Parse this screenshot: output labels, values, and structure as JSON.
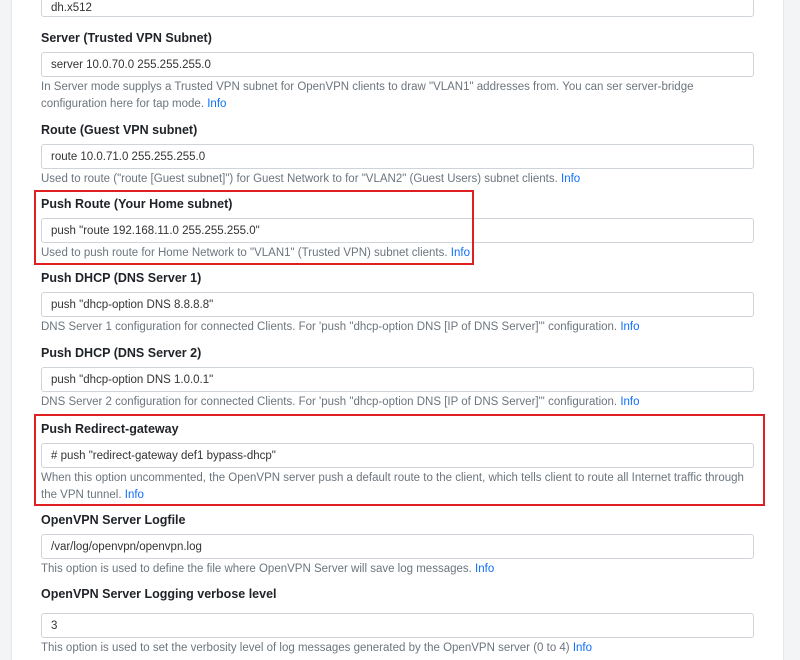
{
  "fields": [
    {
      "label": "",
      "value": "dh.x512",
      "help": "",
      "link": ""
    },
    {
      "label": "Server (Trusted VPN Subnet)",
      "value": "server 10.0.70.0 255.255.255.0",
      "help": "In Server mode supplys a Trusted VPN subnet for OpenVPN clients to draw \"VLAN1\" addresses from. You can ser server-bridge configuration here for tap mode.",
      "link": "Info"
    },
    {
      "label": "Route (Guest VPN subnet)",
      "value": "route 10.0.71.0 255.255.255.0",
      "help": "Used to route (\"route [Guest subnet]\") for Guest Network to for \"VLAN2\" (Guest Users) subnet clients.",
      "link": "Info"
    },
    {
      "label": "Push Route (Your Home subnet)",
      "value": "push \"route 192.168.11.0 255.255.255.0\"",
      "help": "Used to push route for Home Network to \"VLAN1\" (Trusted VPN) subnet clients.",
      "link": "Info"
    },
    {
      "label": "Push DHCP (DNS Server 1)",
      "value": "push \"dhcp-option DNS 8.8.8.8\"",
      "help": "DNS Server 1 configuration for connected Clients. For 'push \"dhcp-option DNS [IP of DNS Server]\"' configuration.",
      "link": "Info"
    },
    {
      "label": "Push DHCP (DNS Server 2)",
      "value": "push \"dhcp-option DNS 1.0.0.1\"",
      "help": "DNS Server 2 configuration for connected Clients. For 'push \"dhcp-option DNS [IP of DNS Server]\"' configuration.",
      "link": "Info"
    },
    {
      "label": "Push Redirect-gateway",
      "value": "# push \"redirect-gateway def1 bypass-dhcp\"",
      "help": "When this option uncommented, the OpenVPN server push a default route to the client, which tells client to route all Internet traffic through the VPN tunnel.",
      "link": "Info"
    },
    {
      "label": "OpenVPN Server Logfile",
      "value": "/var/log/openvpn/openvpn.log",
      "help": "This option is used to define the file where OpenVPN Server will save log messages.",
      "link": "Info"
    },
    {
      "label": "OpenVPN Server Logging verbose level",
      "value": "3",
      "help": "This option is used to set the verbosity level of log messages generated by the OpenVPN server (0 to 4)",
      "link": "Info"
    }
  ],
  "highlight_color": "#e02020"
}
